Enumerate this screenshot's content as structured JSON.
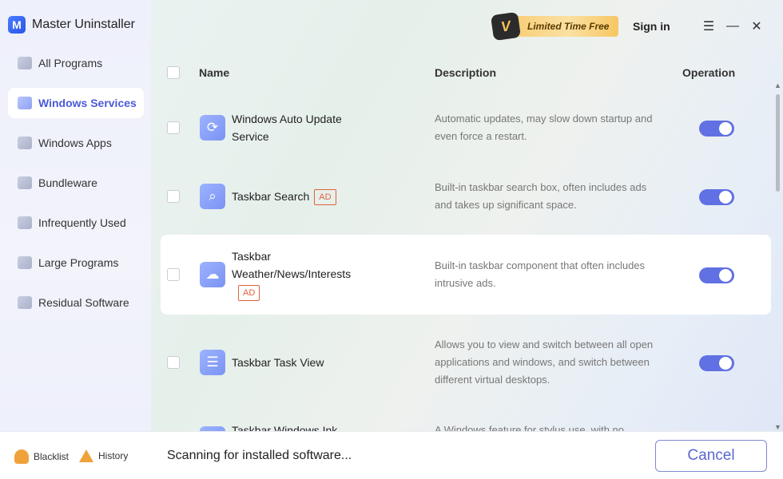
{
  "app": {
    "title": "Master Uninstaller",
    "logo_letter": "M"
  },
  "topbar": {
    "promo_letter": "V",
    "promo_label": "Limited Time Free",
    "signin_label": "Sign in",
    "menu_glyph": "☰",
    "minimize_glyph": "—",
    "close_glyph": "✕"
  },
  "sidebar": {
    "items": [
      {
        "label": "All Programs",
        "icon": "monitor-icon"
      },
      {
        "label": "Windows Services",
        "icon": "windows-icon",
        "active": true
      },
      {
        "label": "Windows Apps",
        "icon": "apps-grid-icon"
      },
      {
        "label": "Bundleware",
        "icon": "link-icon"
      },
      {
        "label": "Infrequently Used",
        "icon": "trash-icon"
      },
      {
        "label": "Large Programs",
        "icon": "folder-icon"
      },
      {
        "label": "Residual Software",
        "icon": "cube-icon"
      }
    ]
  },
  "table": {
    "headers": {
      "name": "Name",
      "description": "Description",
      "operation": "Operation"
    },
    "rows": [
      {
        "name": "Windows Auto Update Service",
        "ad": "",
        "description": "Automatic updates, may slow down startup and even force a restart.",
        "icon": "refresh-icon",
        "enabled": true
      },
      {
        "name": "Taskbar Search",
        "ad": "AD",
        "description": "Built-in taskbar search box, often includes ads and takes up significant space.",
        "icon": "search-icon",
        "enabled": true
      },
      {
        "name": "Taskbar Weather/News/Interests",
        "ad": "AD",
        "description": "Built-in taskbar component that often includes intrusive ads.",
        "icon": "cloud-icon",
        "enabled": true
      },
      {
        "name": "Taskbar Task View",
        "ad": "",
        "description": "Allows you to view and switch between all open applications and windows, and switch between different virtual desktops.",
        "icon": "task-view-icon",
        "enabled": true
      },
      {
        "name": "Taskbar Windows Ink",
        "ad": "",
        "description": "A Windows feature for stylus use, with no",
        "icon": "pen-icon",
        "enabled": true
      }
    ]
  },
  "scrollbar": {
    "up_glyph": "▲",
    "down_glyph": "▼"
  },
  "footer": {
    "blacklist_label": "Blacklist",
    "history_label": "History",
    "status": "Scanning for installed software...",
    "cancel_label": "Cancel"
  },
  "colors": {
    "accent": "#6170e3",
    "ad_badge": "#e2603f",
    "promo": "#f7c96a"
  }
}
